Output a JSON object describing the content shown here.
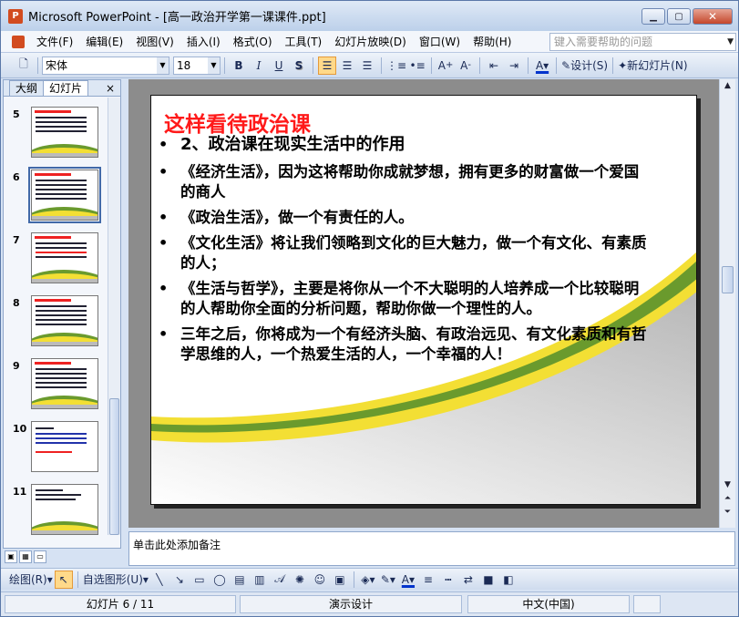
{
  "window": {
    "title": "Microsoft PowerPoint - [高一政治开学第一课课件.ppt]",
    "app_icon": "powerpoint-icon"
  },
  "menubar": {
    "items": [
      "文件(F)",
      "编辑(E)",
      "视图(V)",
      "插入(I)",
      "格式(O)",
      "工具(T)",
      "幻灯片放映(D)",
      "窗口(W)",
      "帮助(H)"
    ],
    "help_placeholder": "键入需要帮助的问题"
  },
  "toolbar": {
    "font_name": "宋体",
    "font_size": "18",
    "bold": "B",
    "italic": "I",
    "underline": "U",
    "shadow": "S",
    "design_label": "设计(S)",
    "new_slide_label": "新幻灯片(N)"
  },
  "pane": {
    "tab_outline": "大纲",
    "tab_slides": "幻灯片",
    "close": "×"
  },
  "thumbnails": [
    {
      "num": "5"
    },
    {
      "num": "6"
    },
    {
      "num": "7"
    },
    {
      "num": "8"
    },
    {
      "num": "9"
    },
    {
      "num": "10"
    },
    {
      "num": "11"
    }
  ],
  "slide": {
    "title": "这样看待政治课",
    "heading": "2、政治课在现实生活中的作用",
    "bullets": [
      "《经济生活》，因为这将帮助你成就梦想，拥有更多的财富做一个爱国的商人",
      "《政治生活》，做一个有责任的人。",
      "《文化生活》将让我们领略到文化的巨大魅力，做一个有文化、有素质的人；",
      "《生活与哲学》，主要是将你从一个不大聪明的人培养成一个比较聪明的人帮助你全面的分析问题，帮助你做一个理性的人。",
      "三年之后，你将成为一个有经济头脑、有政治远见、有文化素质和有哲学思维的人，一个热爱生活的人，一个幸福的人！"
    ]
  },
  "notes": {
    "placeholder": "单击此处添加备注"
  },
  "drawbar": {
    "draw_label": "绘图(R)",
    "autoshape_label": "自选图形(U)"
  },
  "status": {
    "slide_indicator": "幻灯片 6 / 11",
    "design": "演示设计",
    "language": "中文(中国)"
  },
  "colors": {
    "title_red": "#ff1a1a",
    "wave_green": "#6a9a2d",
    "wave_yellow": "#f3df34",
    "selected_outline": "#4169a8"
  }
}
